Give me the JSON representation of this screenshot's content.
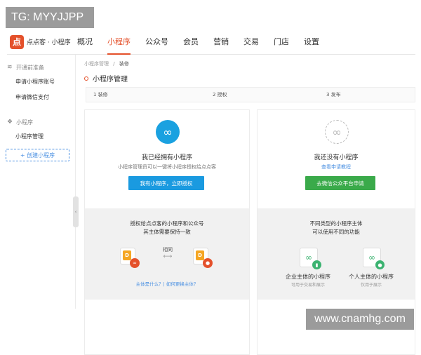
{
  "watermarks": {
    "top_left": "TG: MYYJJPP",
    "bottom_right": "www.cnamhg.com"
  },
  "brand": {
    "mark": "点",
    "name": "点点客 · 小程序",
    "color": "#e4512b"
  },
  "nav": {
    "items": [
      "概况",
      "小程序",
      "公众号",
      "会员",
      "营销",
      "交易",
      "门店",
      "设置"
    ],
    "active_index": 1
  },
  "sidebar": {
    "group1": "开通前准备",
    "group1_items": [
      "申请小程序账号",
      "申请微信支付"
    ],
    "group2": "小程序",
    "group2_items": [
      "小程序管理"
    ],
    "create_button": "+ 创建小程序",
    "collapse_glyph": "‹"
  },
  "main": {
    "breadcrumb": {
      "parent": "小程序管理",
      "separator": "/",
      "current": "装修"
    },
    "page_title": "小程序管理",
    "steps": [
      "1 装修",
      "2 授权",
      "3 发布"
    ]
  },
  "card_left": {
    "title": "我已经拥有小程序",
    "subtitle": "小程序管理员可以一键将小程序授权给点点客",
    "button": "我有小程序，立即授权",
    "lower_title_line1": "授权给点点客的小程序和公众号",
    "lower_title_line2": "其主体需要保持一致",
    "same_label": "相同",
    "link": "主体是什么？| 如何更换主体？",
    "icon_color": "#1aa1e0",
    "button_color": "#1a9ae0"
  },
  "card_right": {
    "title": "我还没有小程序",
    "link_top": "查看申请教程",
    "button": "去微信公众平台申请",
    "lower_title_line1": "不同类型的小程序主体",
    "lower_title_line2": "可以使用不同的功能",
    "option1_title": "企业主体的小程序",
    "option1_sub": "可用于交易和展示",
    "option2_title": "个人主体的小程序",
    "option2_sub": "仅用于展示",
    "button_color": "#3aaa4a"
  },
  "icons": {
    "miniprogram": "∞",
    "person": "●",
    "chart": "▮"
  }
}
